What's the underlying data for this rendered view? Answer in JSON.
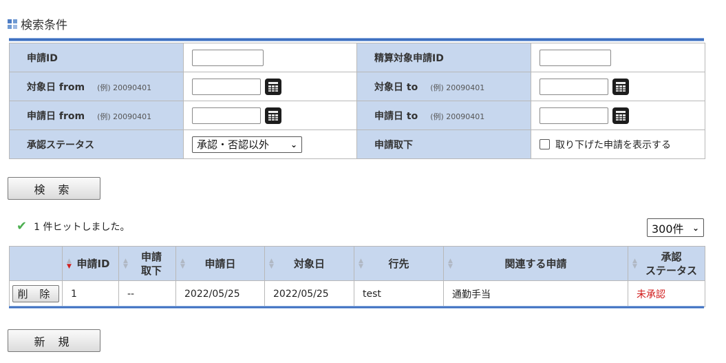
{
  "search_section": {
    "title": "検索条件",
    "fields": {
      "application_id_label": "申請ID",
      "settlement_target_label": "精算対象申請ID",
      "target_date_from_label": "対象日 from",
      "target_date_to_label": "対象日 to",
      "apply_date_from_label": "申請日 from",
      "apply_date_to_label": "申請日 to",
      "example": "(例) 20090401",
      "approval_status_label": "承認ステータス",
      "approval_status_value": "承認・否認以外",
      "withdrawal_label": "申請取下",
      "withdrawal_checkbox_label": "取り下げた申請を表示する"
    },
    "search_button": "検 索"
  },
  "results": {
    "hit_message": "1 件ヒットしました。",
    "page_size": "300件",
    "columns": [
      "申請ID",
      "申請取下",
      "申請日",
      "対象日",
      "行先",
      "関連する申請",
      "承認ステータス"
    ],
    "column_lines": {
      "withdrawal_1": "申請",
      "withdrawal_2": "取下",
      "status_1": "承認",
      "status_2": "ステータス"
    },
    "rows": [
      {
        "action": "削 除",
        "id": "1",
        "withdrawn": "--",
        "apply_date": "2022/05/25",
        "target_date": "2022/05/25",
        "destination": "test",
        "related": "通勤手当",
        "status": "未承認"
      }
    ]
  },
  "new_button": "新 規",
  "colors": {
    "label_bg": "#c7d7ee",
    "accent_bar": "#3f70c0",
    "status_unapproved": "#d01818",
    "hit_check": "#4caf50"
  }
}
